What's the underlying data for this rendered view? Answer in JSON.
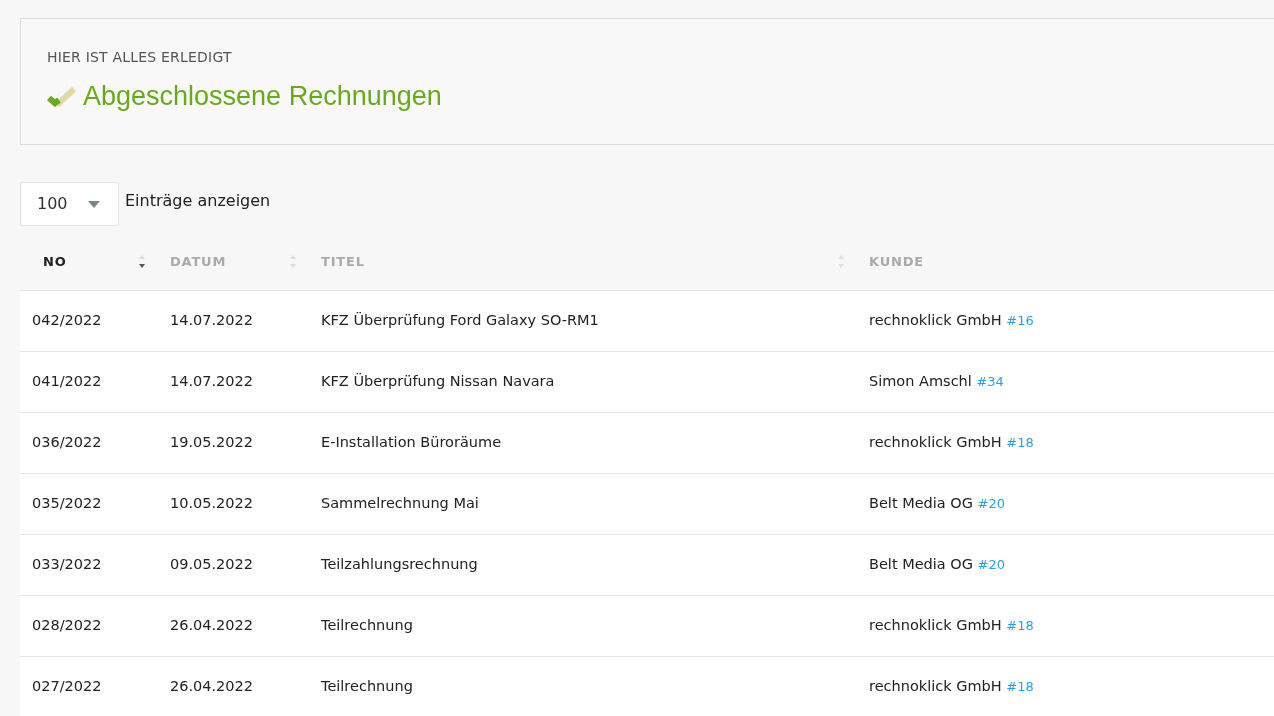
{
  "header": {
    "subtitle": "HIER IST ALLES ERLEDIGT",
    "title": "Abgeschlossene Rechnungen"
  },
  "length": {
    "value": "100",
    "label": "Einträge anzeigen"
  },
  "table": {
    "columns": [
      {
        "label": "NO",
        "sorted": true
      },
      {
        "label": "DATUM",
        "sorted": false
      },
      {
        "label": "TITEL",
        "sorted": false
      },
      {
        "label": "KUNDE",
        "sorted": false
      }
    ],
    "rows": [
      {
        "no": "042/2022",
        "datum": "14.07.2022",
        "titel": "KFZ Überprüfung Ford Galaxy SO-RM1",
        "kunde": "rechnoklick GmbH",
        "kunde_id": "#16"
      },
      {
        "no": "041/2022",
        "datum": "14.07.2022",
        "titel": "KFZ Überprüfung Nissan Navara",
        "kunde": "Simon Amschl",
        "kunde_id": "#34"
      },
      {
        "no": "036/2022",
        "datum": "19.05.2022",
        "titel": "E-Installation Büroräume",
        "kunde": "rechnoklick GmbH",
        "kunde_id": "#18"
      },
      {
        "no": "035/2022",
        "datum": "10.05.2022",
        "titel": "Sammelrechnung Mai",
        "kunde": "Belt Media OG",
        "kunde_id": "#20"
      },
      {
        "no": "033/2022",
        "datum": "09.05.2022",
        "titel": "Teilzahlungsrechnung",
        "kunde": "Belt Media OG",
        "kunde_id": "#20"
      },
      {
        "no": "028/2022",
        "datum": "26.04.2022",
        "titel": "Teilrechnung",
        "kunde": "rechnoklick GmbH",
        "kunde_id": "#18"
      },
      {
        "no": "027/2022",
        "datum": "26.04.2022",
        "titel": "Teilrechnung",
        "kunde": "rechnoklick GmbH",
        "kunde_id": "#18"
      }
    ]
  }
}
